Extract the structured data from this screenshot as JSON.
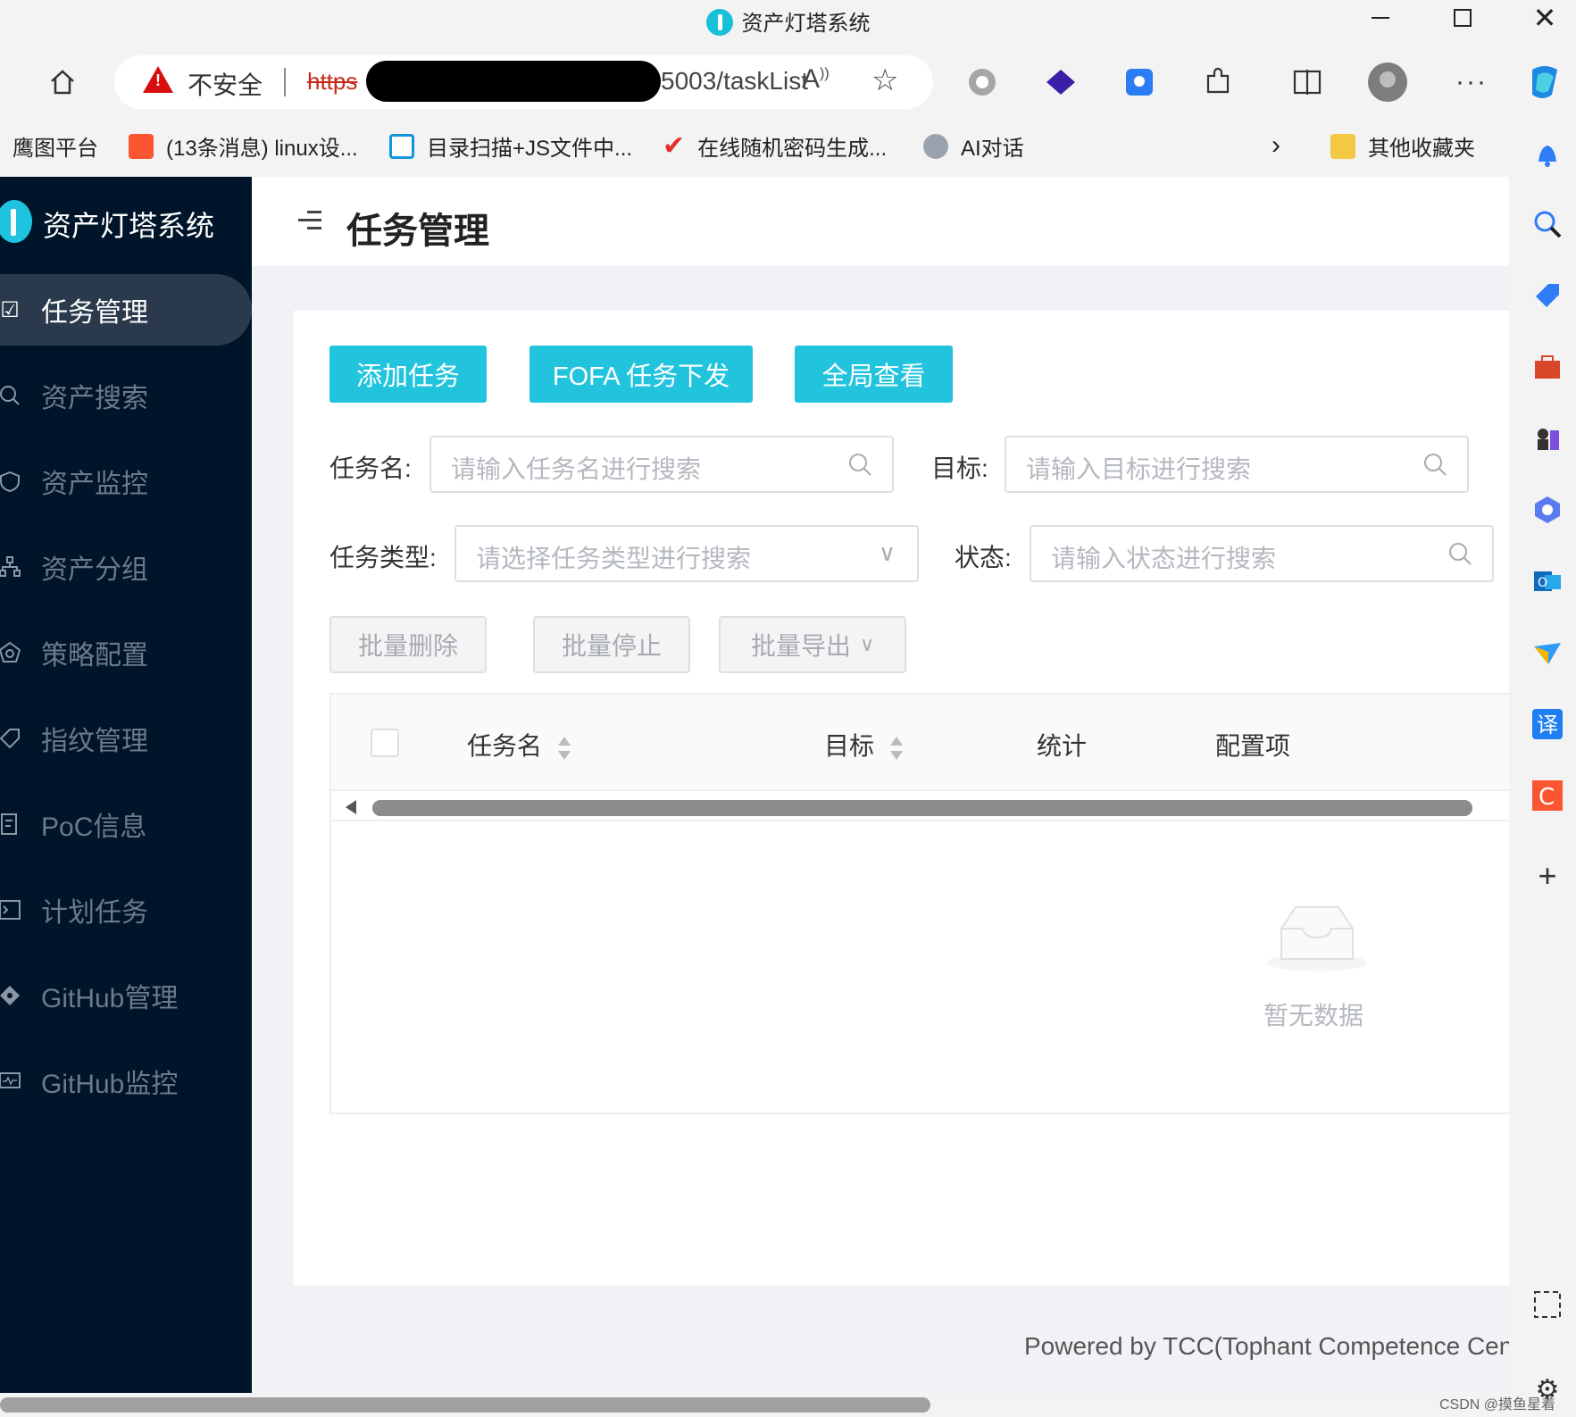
{
  "window": {
    "title": "资产灯塔系统"
  },
  "browser": {
    "address": {
      "security_label": "不安全",
      "scheme": "https",
      "url_visible": "5003/taskList"
    },
    "bookmarks": [
      {
        "label": "鹰图平台",
        "icon": "none"
      },
      {
        "label": "(13条消息) linux设...",
        "icon": "csdn-icon"
      },
      {
        "label": "目录扫描+JS文件中...",
        "icon": "bilibili-icon"
      },
      {
        "label": "在线随机密码生成...",
        "icon": "checkmark-icon"
      },
      {
        "label": "AI对话",
        "icon": "bird-icon"
      }
    ],
    "other_bookmarks": "其他收藏夹"
  },
  "app": {
    "brand": "资产灯塔系统",
    "menu": [
      {
        "label": "任务管理",
        "icon": "task-check-icon",
        "active": true
      },
      {
        "label": "资产搜索",
        "icon": "search-icon",
        "active": false
      },
      {
        "label": "资产监控",
        "icon": "shield-icon",
        "active": false
      },
      {
        "label": "资产分组",
        "icon": "hierarchy-icon",
        "active": false
      },
      {
        "label": "策略配置",
        "icon": "settings-pentagon-icon",
        "active": false
      },
      {
        "label": "指纹管理",
        "icon": "tag-icon",
        "active": false
      },
      {
        "label": "PoC信息",
        "icon": "document-icon",
        "active": false
      },
      {
        "label": "计划任务",
        "icon": "terminal-icon",
        "active": false
      },
      {
        "label": "GitHub管理",
        "icon": "git-icon",
        "active": false
      },
      {
        "label": "GitHub监控",
        "icon": "monitor-icon",
        "active": false
      }
    ],
    "page_title": "任务管理",
    "actions": {
      "add": "添加任务",
      "fofa": "FOFA 任务下发",
      "global": "全局查看"
    },
    "filters": {
      "task_name": {
        "label": "任务名:",
        "placeholder": "请输入任务名进行搜索"
      },
      "target": {
        "label": "目标:",
        "placeholder": "请输入目标进行搜索"
      },
      "task_type": {
        "label": "任务类型:",
        "placeholder": "请选择任务类型进行搜索"
      },
      "status": {
        "label": "状态:",
        "placeholder": "请输入状态进行搜索"
      }
    },
    "batch": {
      "delete": "批量删除",
      "stop": "批量停止",
      "export": "批量导出"
    },
    "table": {
      "columns": [
        "任务名",
        "目标",
        "统计",
        "配置项"
      ],
      "empty_text": "暂无数据"
    },
    "footer": "Powered by TCC(Tophant Competence Cent"
  },
  "watermark": "CSDN @摸鱼星着",
  "colors": {
    "primary": "#22c4dd",
    "sidebar": "#001529",
    "active_menu": "#2a3a4c"
  }
}
